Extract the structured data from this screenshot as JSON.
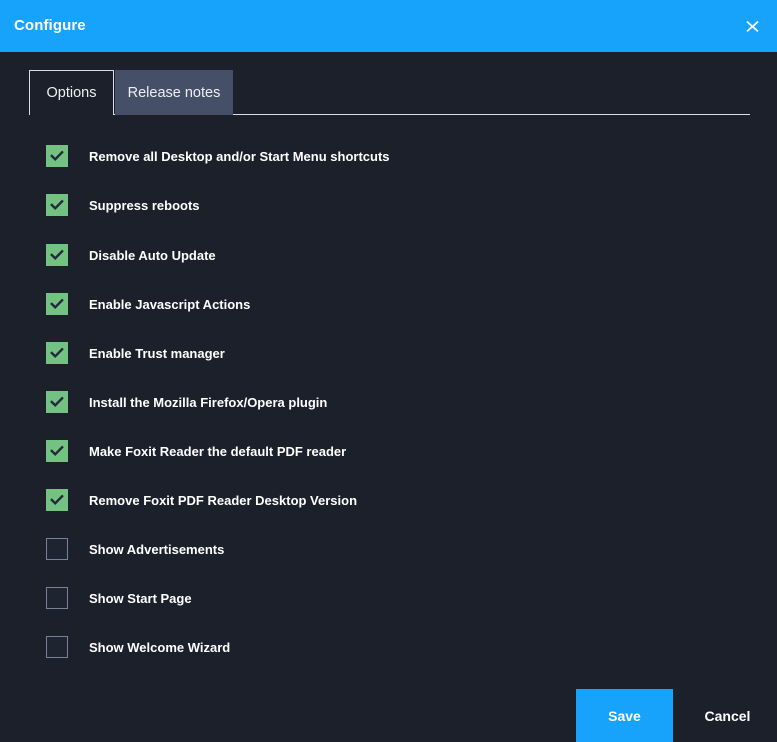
{
  "window": {
    "title": "Configure",
    "close_icon": "close-icon",
    "header_color": "#17a2fb",
    "background_color": "#1c202b"
  },
  "tabs": [
    {
      "label": "Options",
      "active": true
    },
    {
      "label": "Release notes",
      "active": false
    }
  ],
  "options": [
    {
      "label": "Remove all Desktop and/or Start Menu shortcuts",
      "checked": true
    },
    {
      "label": "Suppress reboots",
      "checked": true
    },
    {
      "label": "Disable Auto Update",
      "checked": true
    },
    {
      "label": "Enable Javascript Actions",
      "checked": true
    },
    {
      "label": "Enable Trust manager",
      "checked": true
    },
    {
      "label": "Install the Mozilla Firefox/Opera plugin",
      "checked": true
    },
    {
      "label": "Make Foxit Reader the default PDF reader",
      "checked": true
    },
    {
      "label": "Remove Foxit PDF Reader Desktop Version",
      "checked": true
    },
    {
      "label": "Show Advertisements",
      "checked": false
    },
    {
      "label": "Show Start Page",
      "checked": false
    },
    {
      "label": "Show Welcome Wizard",
      "checked": false
    }
  ],
  "footer": {
    "save_label": "Save",
    "cancel_label": "Cancel",
    "save_color": "#17a2fb"
  },
  "colors": {
    "checkbox_checked": "#74c282",
    "checkbox_unchecked_border": "#7a8299",
    "tab_inactive_bg": "#455068",
    "tab_border": "#d8dde6"
  }
}
